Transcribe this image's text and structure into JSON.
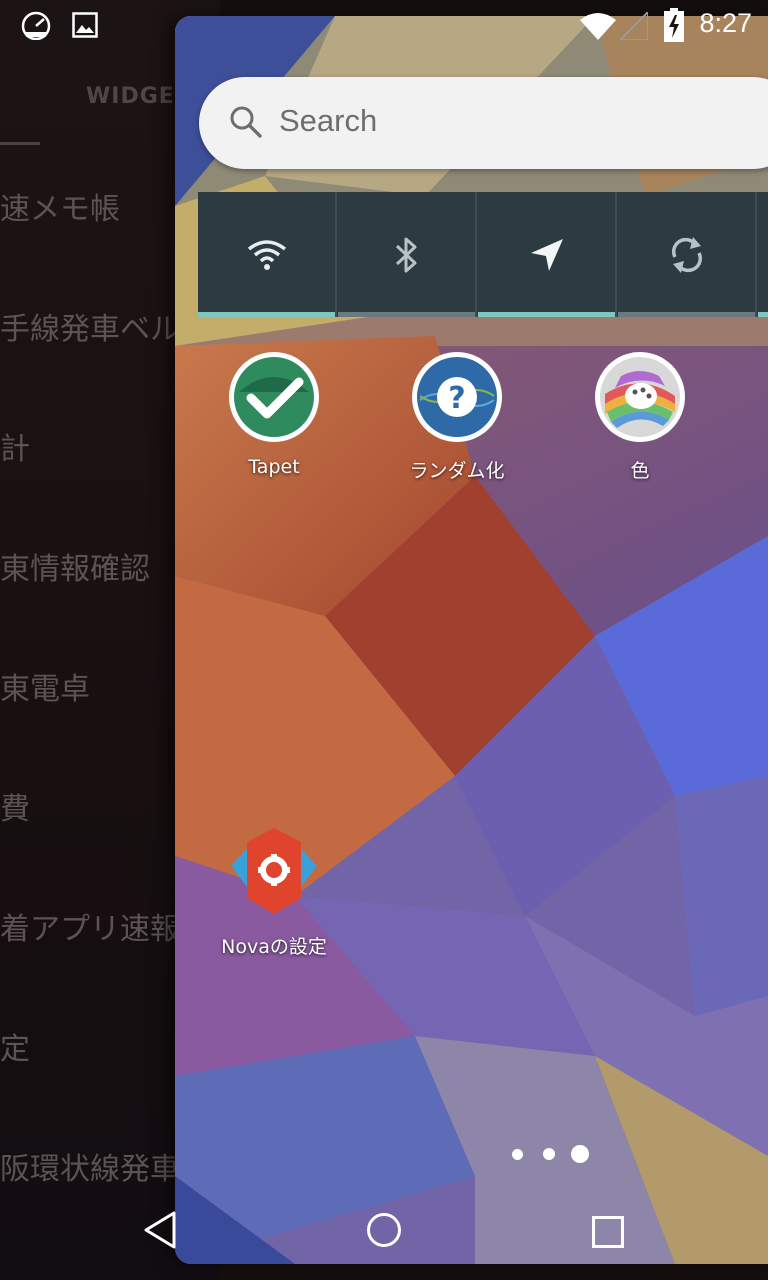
{
  "status_bar": {
    "time": "8:27",
    "left_icons": [
      "speedometer-icon",
      "image-icon"
    ],
    "right_icons": [
      "wifi-icon",
      "signal-icon",
      "battery-charging-icon"
    ]
  },
  "drawer": {
    "tab_label": "WIDGET",
    "items": [
      "速メモ帳",
      "手線発車ベル",
      "計",
      "東情報確認",
      "東電卓",
      "費",
      "着アプリ速報",
      "定",
      "阪環状線発車ベ"
    ]
  },
  "search": {
    "placeholder": "Search"
  },
  "toggles": [
    {
      "name": "wifi",
      "icon": "wifi-icon",
      "on": true
    },
    {
      "name": "bluetooth",
      "icon": "bluetooth-icon",
      "on": false
    },
    {
      "name": "location",
      "icon": "location-icon",
      "on": true
    },
    {
      "name": "sync",
      "icon": "sync-icon",
      "on": false
    }
  ],
  "apps": [
    {
      "label": "Tapet",
      "icon": "tapet-check-icon"
    },
    {
      "label": "ランダム化",
      "icon": "random-question-icon"
    },
    {
      "label": "色",
      "icon": "color-palette-icon"
    },
    {
      "label": "Novaの設定",
      "icon": "nova-settings-icon"
    }
  ],
  "page_indicator": {
    "pages": 3,
    "current": 3
  },
  "nav": {
    "buttons": [
      "back-icon",
      "home-icon",
      "recents-icon"
    ]
  },
  "colors": {
    "toggle_on": "#7ec6c0",
    "toggle_bg": "#2c3a42",
    "search_bg": "#f2f2f2"
  }
}
